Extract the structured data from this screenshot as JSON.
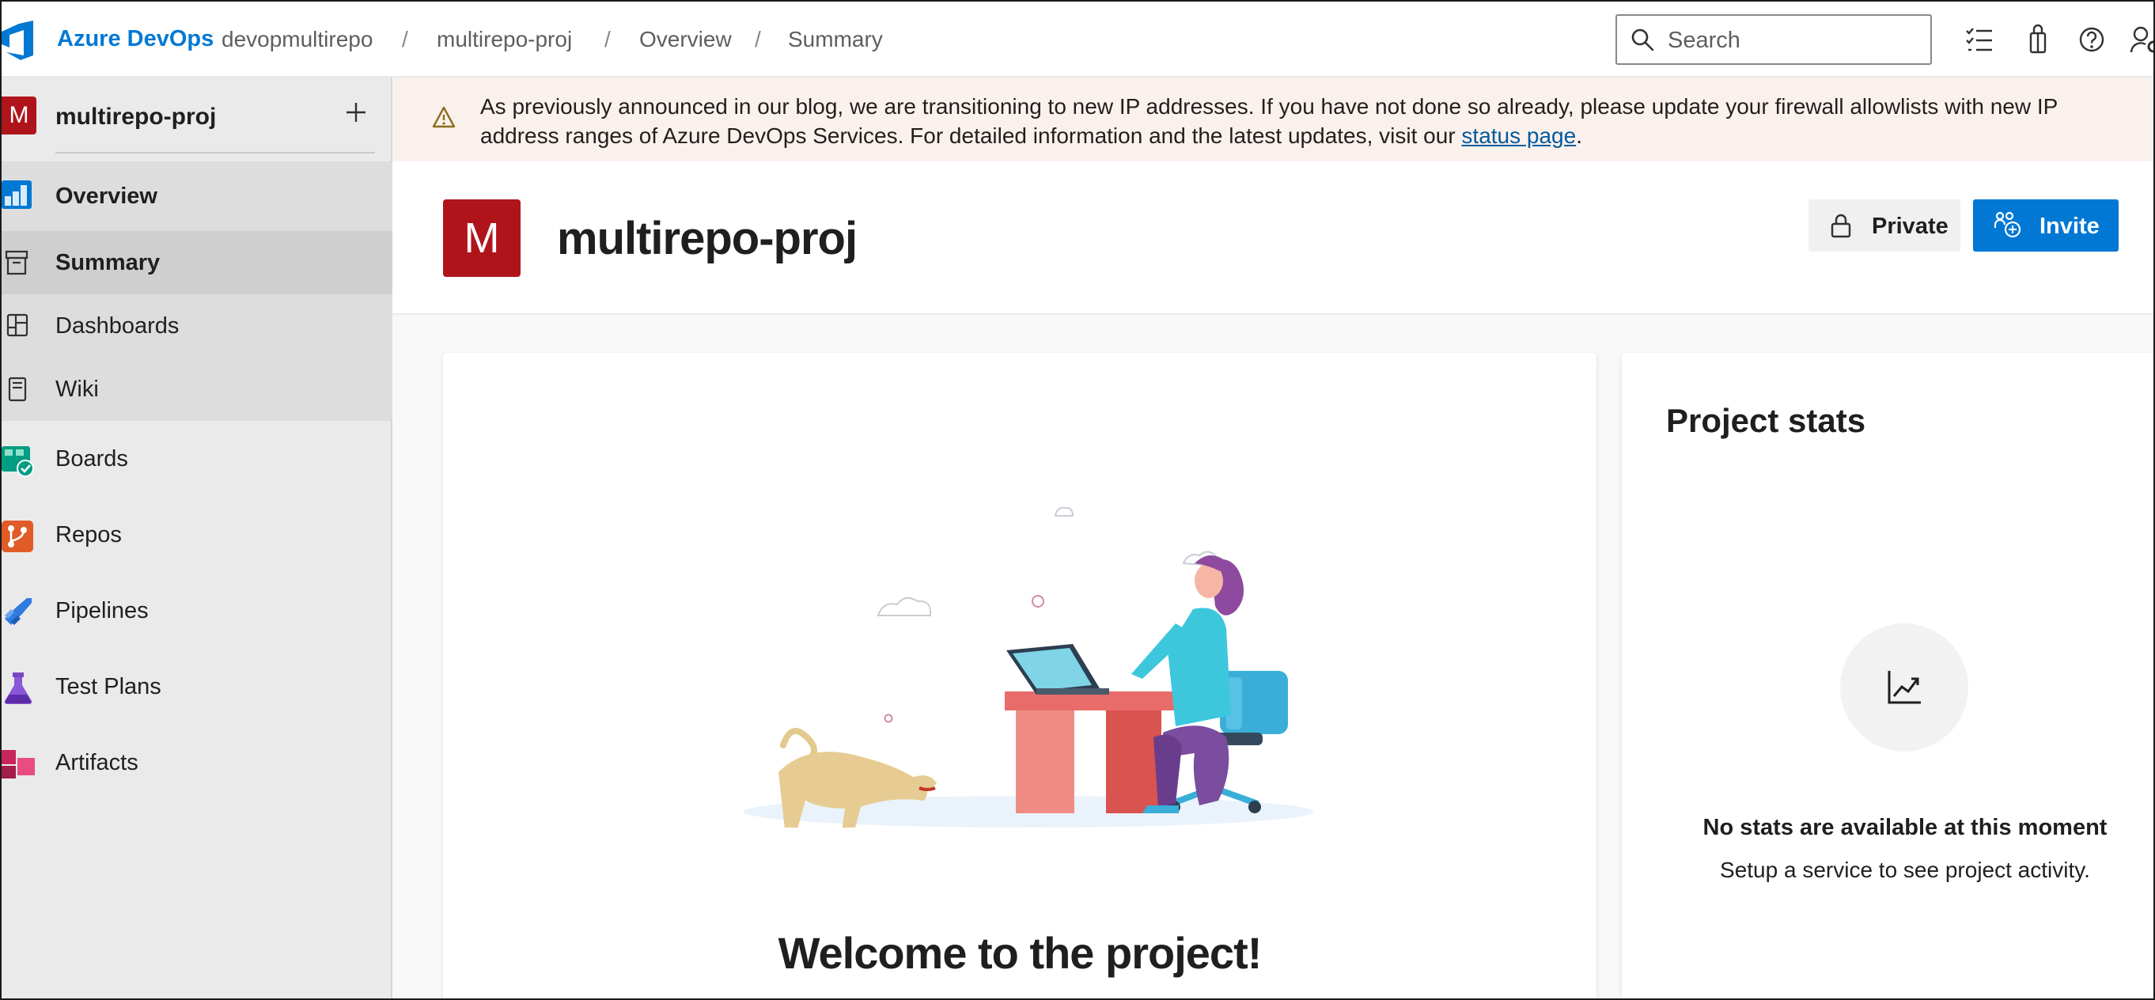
{
  "app": {
    "brand": "Azure DevOps"
  },
  "breadcrumb": {
    "org": "devopmultirepo",
    "project": "multirepo-proj",
    "section": "Overview",
    "page": "Summary",
    "separator": "/"
  },
  "search": {
    "placeholder": "Search"
  },
  "top_icons": [
    "work-items-icon",
    "marketplace-icon",
    "help-icon",
    "user-settings-icon"
  ],
  "sidebar": {
    "project_initial": "M",
    "project_name": "multirepo-proj",
    "items": [
      {
        "label": "Overview",
        "icon": "overview-icon"
      },
      {
        "label": "Summary",
        "icon": "summary-icon"
      },
      {
        "label": "Dashboards",
        "icon": "dashboards-icon"
      },
      {
        "label": "Wiki",
        "icon": "wiki-icon"
      },
      {
        "label": "Boards",
        "icon": "boards-icon"
      },
      {
        "label": "Repos",
        "icon": "repos-icon"
      },
      {
        "label": "Pipelines",
        "icon": "pipelines-icon"
      },
      {
        "label": "Test Plans",
        "icon": "test-plans-icon"
      },
      {
        "label": "Artifacts",
        "icon": "artifacts-icon"
      }
    ]
  },
  "banner": {
    "text": "As previously announced in our blog, we are transitioning to new IP addresses. If you have not done so already, please update your firewall allowlists with new IP address ranges of Azure DevOps Services. For detailed information and the latest updates, visit our ",
    "link_text": "status page",
    "suffix": "."
  },
  "header": {
    "initial": "M",
    "title": "multirepo-proj",
    "private_label": "Private",
    "invite_label": "Invite"
  },
  "welcome": {
    "title": "Welcome to the project!"
  },
  "stats": {
    "title": "Project stats",
    "empty_title": "No stats are available at this moment",
    "empty_sub": "Setup a service to see project activity."
  },
  "colors": {
    "brand": "#0078d4",
    "project_avatar": "#b0141b",
    "banner_bg": "#fbf1ec",
    "sidebar_bg": "#eaeaea"
  }
}
